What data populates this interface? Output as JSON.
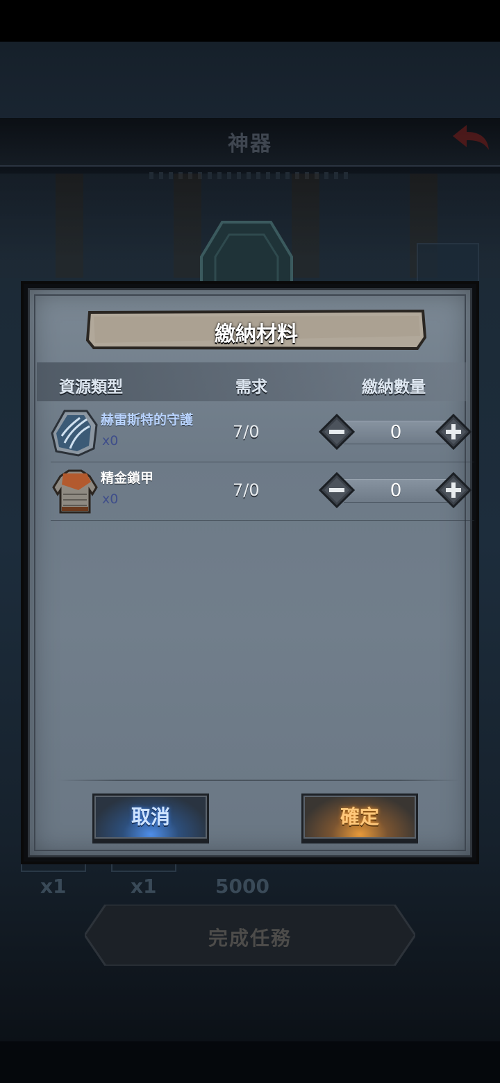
{
  "background": {
    "screen_title": "神器",
    "reward_counts": [
      "x1",
      "x1",
      "5000"
    ],
    "complete_button_label": "完成任務"
  },
  "dialog": {
    "title": "繳納材料",
    "columns": {
      "resource_type": "資源類型",
      "requirement": "需求",
      "submit_quantity": "繳納數量"
    },
    "items": [
      {
        "name": "赫雷斯特的守護",
        "owned": "x0",
        "requirement": "7/0",
        "quantity": "0",
        "name_color": "#b9d4ff",
        "icon": "shield-icon"
      },
      {
        "name": "精金鎖甲",
        "owned": "x0",
        "requirement": "7/0",
        "quantity": "0",
        "name_color": "#ffffff",
        "icon": "chainmail-armor-icon"
      }
    ],
    "cancel_label": "取消",
    "confirm_label": "確定"
  },
  "colors": {
    "cancel_accent": "#4f8ee8",
    "confirm_accent": "#e89a3a",
    "owned_count": "#3f4e8a"
  }
}
